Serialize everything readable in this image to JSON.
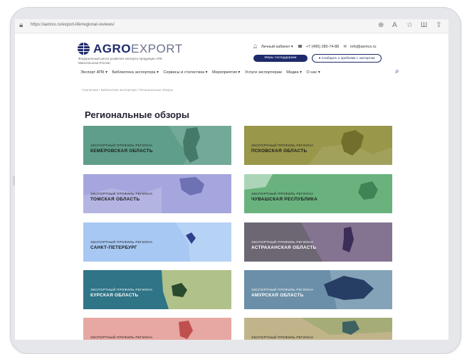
{
  "browser": {
    "url": "https://aemcx.ru/export-life/regional-reviews/",
    "icons": [
      "lock-icon",
      "text-size-icon",
      "reader-icon",
      "favorite-icon",
      "reading-list-icon",
      "share-icon"
    ]
  },
  "header": {
    "logo_bold": "AGRO",
    "logo_light": "EXPORT",
    "tagline": "Федеральный центр развития экспорта продукции АПК Минсельхоза России",
    "account_label": "Личный кабинет ▾",
    "phone": "+7 (495) 280-74-88",
    "email": "info@aemcx.ru",
    "write_button": "Меры господдержки",
    "report_button": "Сообщить о проблеме с экспортом"
  },
  "nav": {
    "items": [
      "Экспорт АПК ▾",
      "Библиотека экспортера ▾",
      "Сервисы и статистика ▾",
      "Мероприятия ▾",
      "Услуги экспортерам",
      "Медиа ▾",
      "О нас ▾"
    ]
  },
  "breadcrumbs": "Аналитика / Библиотека экспортера / Региональные обзоры",
  "page_title": "Региональные обзоры",
  "cards": [
    {
      "kicker": "ЭКСПОРТНЫЙ ПРОФИЛЬ РЕГИОНА",
      "region": "КЕМЕРОВСКАЯ ОБЛАСТЬ",
      "bg": "#5f9e8a",
      "accent": "#457a69"
    },
    {
      "kicker": "ЭКСПОРТНЫЙ ПРОФИЛЬ РЕГИОНА",
      "region": "ПСКОВСКАЯ ОБЛАСТЬ",
      "bg": "#98974a",
      "accent": "#726f2c"
    },
    {
      "kicker": "ЭКСПОРТНЫЙ ПРОФИЛЬ РЕГИОНА",
      "region": "ТОМСКАЯ ОБЛАСТЬ",
      "bg": "#a6a6de",
      "accent": "#6e71b4"
    },
    {
      "kicker": "ЭКСПОРТНЫЙ ПРОФИЛЬ РЕГИОНА",
      "region": "ЧУВАШСКАЯ РЕСПУБЛИКА",
      "bg": "#69b27e",
      "accent": "#3f8455"
    },
    {
      "kicker": "ЭКСПОРТНЫЙ ПРОФИЛЬ РЕГИОНА",
      "region": "САНКТ-ПЕТЕРБУРГ",
      "bg": "#a7c8f2",
      "accent": "#2f3f8c"
    },
    {
      "kicker": "ЭКСПОРТНЫЙ ПРОФИЛЬ РЕГИОНА",
      "region": "АСТРАХАНСКАЯ ОБЛАСТЬ",
      "bg": "#6d6673",
      "accent": "#3c2d58"
    },
    {
      "kicker": "ЭКСПОРТНЫЙ ПРОФИЛЬ РЕГИОНА",
      "region": "КУРСКАЯ ОБЛАСТЬ",
      "bg": "#2f7487",
      "accent": "#2a4a2f"
    },
    {
      "kicker": "ЭКСПОРТНЫЙ ПРОФИЛЬ РЕГИОНА",
      "region": "АМУРСКАЯ ОБЛАСТЬ",
      "bg": "#6b8fa8",
      "accent": "#263e63"
    },
    {
      "kicker": "ЭКСПОРТНЫЙ ПРОФИЛЬ РЕГИОНА",
      "region": "",
      "bg": "#e7a7a2",
      "accent": "#c0504d"
    },
    {
      "kicker": "ЭКСПОРТНЫЙ ПРОФИЛЬ РЕГИОНА",
      "region": "",
      "bg": "#c2b48a",
      "accent": "#3e6262"
    }
  ]
}
